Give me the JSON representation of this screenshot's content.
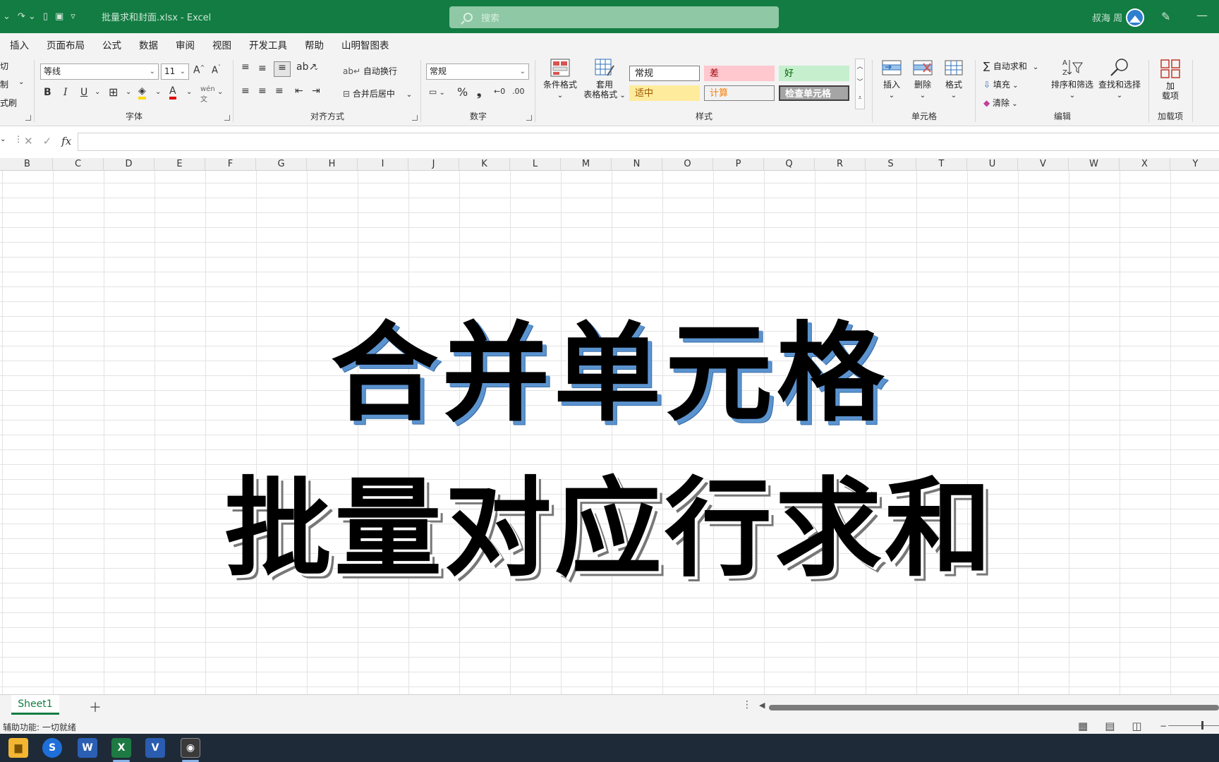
{
  "titlebar": {
    "doc_title": "批量求和封面.xlsx  -  Excel",
    "search_placeholder": "搜索",
    "user_name": "叔海 周"
  },
  "menu": {
    "tabs": [
      "插入",
      "页面布局",
      "公式",
      "数据",
      "审阅",
      "视图",
      "开发工具",
      "帮助",
      "山明智图表"
    ]
  },
  "ribbon": {
    "clipboard": {
      "cut": "剪切",
      "copy": "复制",
      "format_painter": "格式刷"
    },
    "font": {
      "label": "字体",
      "font_name": "等线",
      "font_size": "11",
      "bold": "B",
      "italic": "I",
      "underline": "U"
    },
    "alignment": {
      "label": "对齐方式",
      "wrap_text": "自动换行",
      "merge_center": "合并后居中"
    },
    "number": {
      "label": "数字",
      "format": "常规",
      "percent": "%",
      "comma": "❟"
    },
    "styles": {
      "label": "样式",
      "conditional_format": "条件格式",
      "table_format_1": "套用",
      "table_format_2": "表格格式",
      "cells": [
        {
          "name": "常规",
          "bg": "#ffffff",
          "fg": "#222222",
          "border": "#7a7a7a"
        },
        {
          "name": "差",
          "bg": "#ffc7ce",
          "fg": "#9c0006",
          "border": "#ffc7ce"
        },
        {
          "name": "好",
          "bg": "#c6efce",
          "fg": "#006100",
          "border": "#c6efce"
        },
        {
          "name": "适中",
          "bg": "#ffeb9c",
          "fg": "#9c5700",
          "border": "#ffeb9c"
        },
        {
          "name": "计算",
          "bg": "#f2f2f2",
          "fg": "#fa7d00",
          "border": "#7f7f7f"
        },
        {
          "name": "检查单元格",
          "bg": "#a5a5a5",
          "fg": "#ffffff",
          "border": "#3f3f3f"
        }
      ]
    },
    "cells": {
      "label": "单元格",
      "insert": "插入",
      "delete": "删除",
      "format": "格式"
    },
    "editing": {
      "label": "编辑",
      "autosum": "自动求和",
      "fill": "填充",
      "clear": "清除",
      "sort_filter": "排序和筛选",
      "find_select": "查找和选择"
    },
    "addins": {
      "label": "加载项",
      "addin_1": "加",
      "addin_2": "载项"
    }
  },
  "formula_bar": {
    "fx": "fx",
    "value": ""
  },
  "columns": [
    "B",
    "C",
    "D",
    "E",
    "F",
    "G",
    "H",
    "I",
    "J",
    "K",
    "L",
    "M",
    "N",
    "O",
    "P",
    "Q",
    "R",
    "S",
    "T",
    "U",
    "V",
    "W",
    "X",
    "Y"
  ],
  "sheet_content": {
    "line1": "合并单元格",
    "line2": "批量对应行求和"
  },
  "sheet_tabs": [
    "Sheet1"
  ],
  "status": {
    "accessibility": "辅助功能: 一切就绪"
  },
  "colors": {
    "excel_green": "#127c42",
    "taskbar": "#1f2a38"
  }
}
